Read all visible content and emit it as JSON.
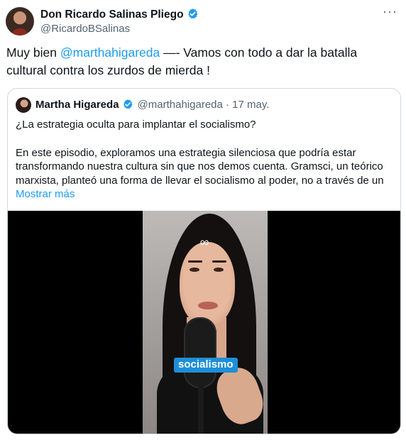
{
  "author": {
    "name": "Don Ricardo Salinas Pliego",
    "handle": "@RicardoBSalinas"
  },
  "more_label": "···",
  "tweet": {
    "text_prefix": "Muy bien ",
    "mention": "@marthahigareda",
    "text_suffix": " —- Vamos con todo a dar la batalla cultural contra los zurdos de mierda !"
  },
  "quoted": {
    "name": "Martha Higareda",
    "handle_date": "@marthahigareda · 17 may.",
    "line1": "¿La estrategia oculta para implantar el socialismo?",
    "paragraph2": "En este episodio, exploramos una estrategia silenciosa que podría estar transformando nuestra cultura sin que nos demos cuenta. Gramsci, un teórico marxista, planteó una forma de llevar el socialismo al poder, no a través de un",
    "show_more": "Mostrar más",
    "video_caption": "socialismo",
    "logo_glyph": "∞"
  },
  "colors": {
    "accent": "#1d9bf0",
    "text": "#0f1419",
    "muted": "#536471",
    "caption_bg": "#1d8fd8"
  },
  "icons": {
    "verified": "verified-badge-icon",
    "more": "more-icon"
  }
}
